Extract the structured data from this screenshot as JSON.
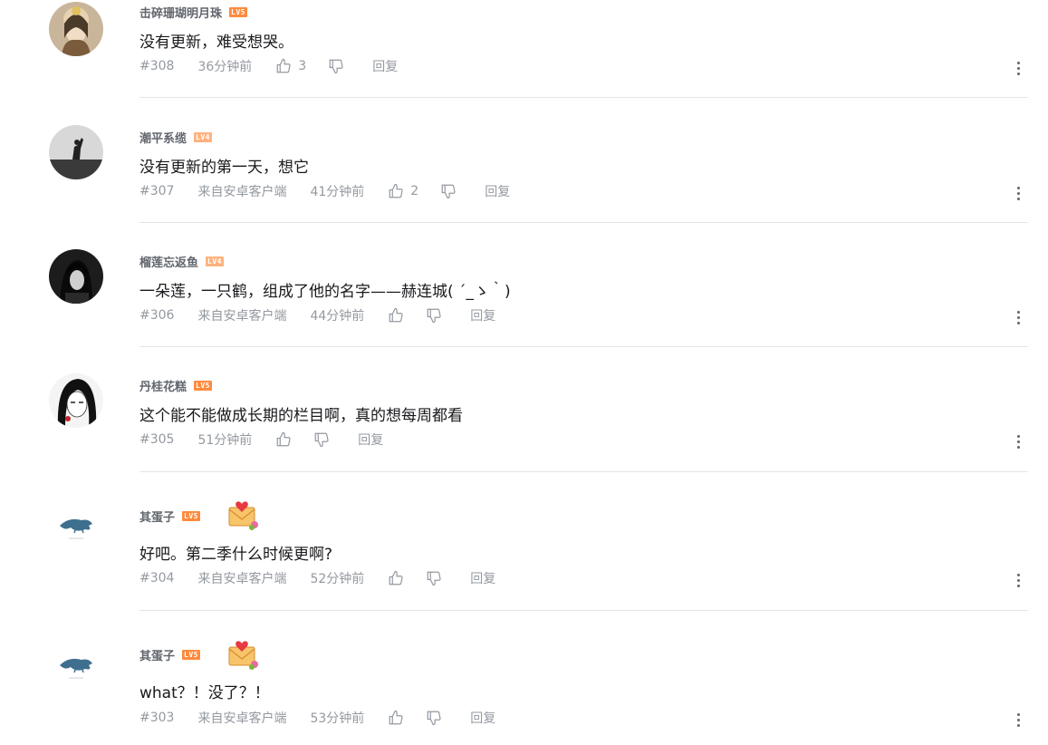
{
  "reply_label": "回复",
  "lv_colors": {
    "LV4": "#ffb27f",
    "LV5": "#ff8a3d"
  },
  "comments": [
    {
      "user": "击碎珊瑚明月珠",
      "level": "LV5",
      "text": "没有更新，难受想哭。",
      "floor": "#308",
      "source": "",
      "time": "36分钟前",
      "likes": "3",
      "avatar": "avatar-princess",
      "badge": ""
    },
    {
      "user": "潮平系缆",
      "level": "LV4",
      "text": "没有更新的第一天，想它",
      "floor": "#307",
      "source": "来自安卓客户端",
      "time": "41分钟前",
      "likes": "2",
      "avatar": "avatar-silhouette",
      "badge": ""
    },
    {
      "user": "榴莲忘返鱼",
      "level": "LV4",
      "text": "一朵莲，一只鹤，组成了他的名字——赫连城( ´_ゝ｀)",
      "floor": "#306",
      "source": "来自安卓客户端",
      "time": "44分钟前",
      "likes": "",
      "avatar": "avatar-darkhair",
      "badge": ""
    },
    {
      "user": "丹桂花糕",
      "level": "LV5",
      "text": "这个能不能做成长期的栏目啊，真的想每周都看",
      "floor": "#305",
      "source": "",
      "time": "51分钟前",
      "likes": "",
      "avatar": "avatar-sketch",
      "badge": ""
    },
    {
      "user": "其蛋子",
      "level": "LV5",
      "text": "好吧。第二季什么时候更啊?",
      "floor": "#304",
      "source": "来自安卓客户端",
      "time": "52分钟前",
      "likes": "",
      "avatar": "avatar-whale",
      "badge": "love-letter-icon"
    },
    {
      "user": "其蛋子",
      "level": "LV5",
      "text": "what？！没了？！",
      "floor": "#303",
      "source": "来自安卓客户端",
      "time": "53分钟前",
      "likes": "",
      "avatar": "avatar-whale",
      "badge": "love-letter-icon"
    }
  ]
}
